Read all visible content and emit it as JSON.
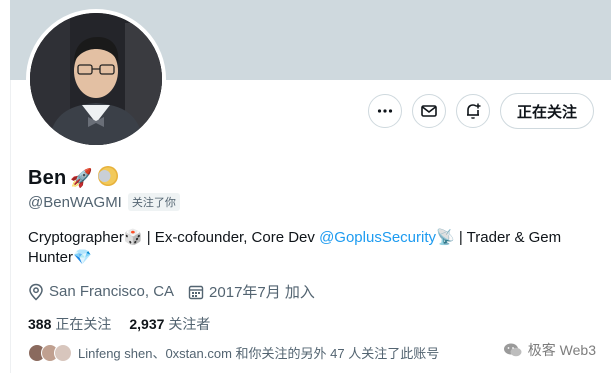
{
  "profile": {
    "name": "Ben",
    "name_emoji": "🚀",
    "handle": "@BenWAGMI",
    "follows_you": "关注了你"
  },
  "actions": {
    "more_icon": "more-icon",
    "message_icon": "mail-icon",
    "notify_icon": "bell-plus-icon",
    "follow_label": "正在关注"
  },
  "bio": {
    "part1": "Cryptographer",
    "emoji1": "🎲",
    "part2": " | Ex-cofounder, Core Dev ",
    "link": "@GoplusSecurity",
    "emoji2": "📡",
    "part3": " | Trader & Gem Hunter",
    "emoji3": "💎"
  },
  "meta": {
    "location": "San Francisco, CA",
    "joined": "2017年7月 加入"
  },
  "stats": {
    "following_count": "388",
    "following_label": "正在关注",
    "followers_count": "2,937",
    "followers_label": "关注者"
  },
  "followed_by": "Linfeng shen、0xstan.com 和你关注的另外 47 人关注了此账号",
  "watermark": "极客 Web3",
  "colors": {
    "banner": "#cfd9de",
    "link": "#1d9bf0",
    "secondary_text": "#536471"
  }
}
